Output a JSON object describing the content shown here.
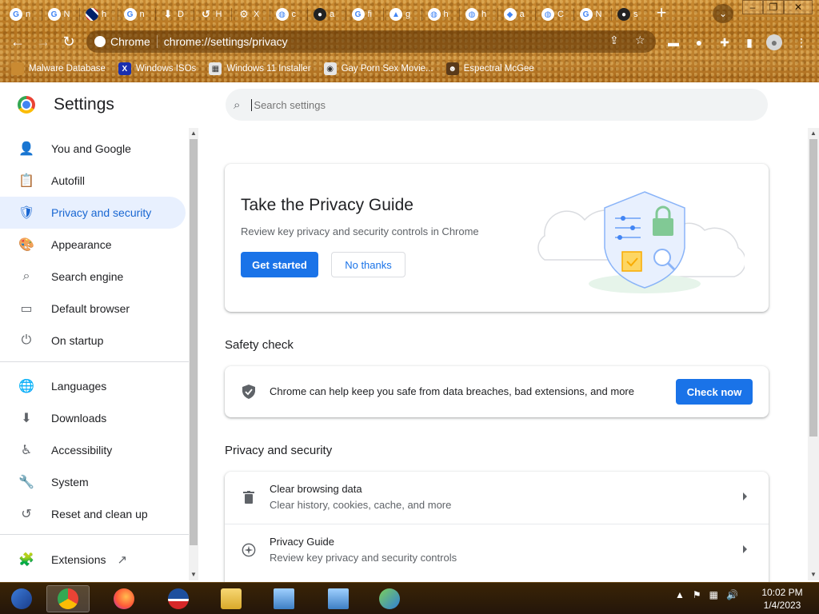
{
  "browser": {
    "tabs": [
      {
        "icon": "google-icon",
        "glyph": "G",
        "title": "n"
      },
      {
        "icon": "google-icon",
        "glyph": "G",
        "title": "N"
      },
      {
        "icon": "flag-icon",
        "glyph": "",
        "title": "h"
      },
      {
        "icon": "google-icon",
        "glyph": "G",
        "title": "n"
      },
      {
        "icon": "download-icon",
        "glyph": "⬇",
        "title": "D"
      },
      {
        "icon": "history-icon",
        "glyph": "↺",
        "title": "H"
      },
      {
        "icon": "gear-icon",
        "glyph": "⚙",
        "title": "X"
      },
      {
        "icon": "globe-icon",
        "glyph": "◍",
        "title": "c"
      },
      {
        "icon": "github-icon",
        "glyph": "●",
        "title": "a"
      },
      {
        "icon": "google-icon",
        "glyph": "G",
        "title": "fi"
      },
      {
        "icon": "drive-icon",
        "glyph": "▲",
        "title": "g"
      },
      {
        "icon": "globe-icon",
        "glyph": "◍",
        "title": "h"
      },
      {
        "icon": "globe-icon",
        "glyph": "◍",
        "title": "h"
      },
      {
        "icon": "shield-icon",
        "glyph": "◆",
        "title": "a"
      },
      {
        "icon": "globe-icon",
        "glyph": "◍",
        "title": "C"
      },
      {
        "icon": "google-icon",
        "glyph": "G",
        "title": "N"
      },
      {
        "icon": "user-icon",
        "glyph": "●",
        "title": "s"
      }
    ],
    "new_tab_glyph": "+",
    "tab_search_glyph": "⌄",
    "window_controls": {
      "minimize": "–",
      "maximize": "❐",
      "close": "✕"
    },
    "nav": {
      "back": "←",
      "forward": "→",
      "reload": "↻"
    },
    "omnibox": {
      "site_label": "Chrome",
      "url": "chrome://settings/privacy"
    },
    "bookmarks": [
      {
        "label": "Malware Database",
        "icon": "bookmark-icon",
        "color": "#c98a32",
        "glyph": ""
      },
      {
        "label": "Windows ISOs",
        "icon": "x-icon",
        "color": "#1a2fb0",
        "glyph": "X"
      },
      {
        "label": "Windows 11 Installer",
        "icon": "image-icon",
        "color": "#e6e6e6",
        "glyph": "▦"
      },
      {
        "label": "Gay Porn Sex Movie...",
        "icon": "site-icon",
        "color": "#e6e6e6",
        "glyph": "◉"
      },
      {
        "label": "Espectral McGee",
        "icon": "avatar-icon",
        "color": "#5a3a1a",
        "glyph": "☻"
      }
    ]
  },
  "settings": {
    "title": "Settings",
    "search_placeholder": "Search settings",
    "sidebar": {
      "items": [
        {
          "label": "You and Google",
          "icon": "person-icon",
          "glyph": "👤",
          "active": false
        },
        {
          "label": "Autofill",
          "icon": "clipboard-icon",
          "glyph": "📋",
          "active": false
        },
        {
          "label": "Privacy and security",
          "icon": "shield-icon",
          "glyph": "🛡",
          "active": true
        },
        {
          "label": "Appearance",
          "icon": "palette-icon",
          "glyph": "🎨",
          "active": false
        },
        {
          "label": "Search engine",
          "icon": "search-icon",
          "glyph": "⌕",
          "active": false
        },
        {
          "label": "Default browser",
          "icon": "browser-icon",
          "glyph": "▭",
          "active": false
        },
        {
          "label": "On startup",
          "icon": "power-icon",
          "glyph": "⏻",
          "active": false
        },
        {
          "label": "Languages",
          "icon": "globe-icon",
          "glyph": "🌐",
          "active": false
        },
        {
          "label": "Downloads",
          "icon": "download-icon",
          "glyph": "⬇",
          "active": false
        },
        {
          "label": "Accessibility",
          "icon": "accessibility-icon",
          "glyph": "♿",
          "active": false
        },
        {
          "label": "System",
          "icon": "wrench-icon",
          "glyph": "🔧",
          "active": false
        },
        {
          "label": "Reset and clean up",
          "icon": "restore-icon",
          "glyph": "↺",
          "active": false
        },
        {
          "label": "Extensions",
          "icon": "puzzle-icon",
          "glyph": "🧩",
          "active": false
        }
      ]
    },
    "privacy_guide": {
      "title": "Take the Privacy Guide",
      "description": "Review key privacy and security controls in Chrome",
      "primary_button": "Get started",
      "secondary_button": "No thanks"
    },
    "safety_check": {
      "heading": "Safety check",
      "text": "Chrome can help keep you safe from data breaches, bad extensions, and more",
      "button": "Check now"
    },
    "privacy_section": {
      "heading": "Privacy and security",
      "rows": [
        {
          "title": "Clear browsing data",
          "subtitle": "Clear history, cookies, cache, and more",
          "icon": "trash-icon"
        },
        {
          "title": "Privacy Guide",
          "subtitle": "Review key privacy and security controls",
          "icon": "compass-icon"
        }
      ]
    }
  },
  "taskbar": {
    "clock_time": "10:02 PM",
    "clock_date": "1/4/2023"
  },
  "colors": {
    "accent": "#1a73e8",
    "active_nav_bg": "#e8f0fe",
    "active_nav_text": "#1967d2"
  }
}
